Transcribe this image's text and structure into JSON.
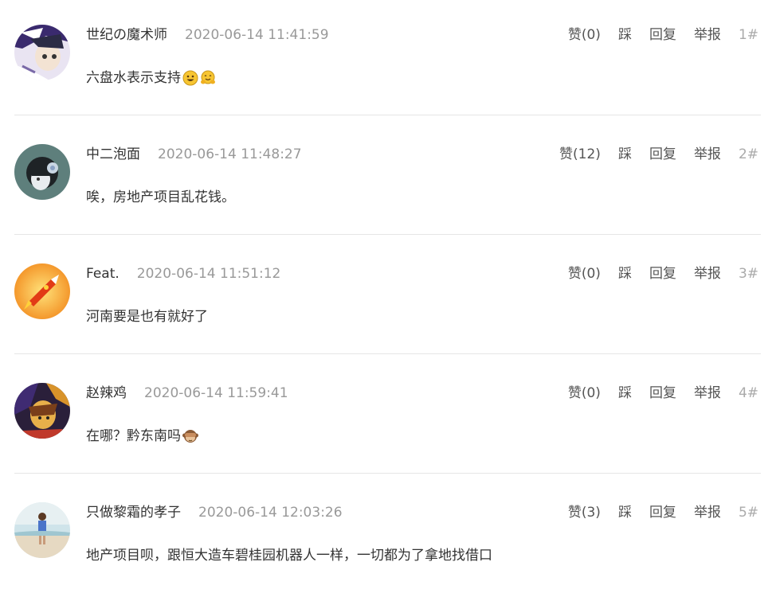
{
  "colors": {
    "text": "#333333",
    "muted": "#999999",
    "divider": "#e6e6e6"
  },
  "comments": [
    {
      "username": "世纪の魔术师",
      "time": "2020-06-14 11:41:59",
      "like": "赞(0)",
      "dislike": "踩",
      "reply": "回复",
      "report": "举报",
      "floor": "1#",
      "text": "六盘水表示支持",
      "emojis": [
        "grinning-face-emoji",
        "hugging-face-emoji"
      ],
      "avatar": "anime-magician-avatar"
    },
    {
      "username": "中二泡面",
      "time": "2020-06-14 11:48:27",
      "like": "赞(12)",
      "dislike": "踩",
      "reply": "回复",
      "report": "举报",
      "floor": "2#",
      "text": "唉，房地产项目乱花钱。",
      "emojis": [],
      "avatar": "anime-dark-hair-avatar"
    },
    {
      "username": "Feat.",
      "time": "2020-06-14 11:51:12",
      "like": "赞(0)",
      "dislike": "踩",
      "reply": "回复",
      "report": "举报",
      "floor": "3#",
      "text": "河南要是也有就好了",
      "emojis": [],
      "avatar": "orange-rocket-avatar"
    },
    {
      "username": "赵辣鸡",
      "time": "2020-06-14 11:59:41",
      "like": "赞(0)",
      "dislike": "踩",
      "reply": "回复",
      "report": "举报",
      "floor": "4#",
      "text": "在哪？黔东南吗",
      "emojis": [
        "see-no-evil-monkey-emoji"
      ],
      "avatar": "colorful-character-avatar"
    },
    {
      "username": "只做黎霜的孝子",
      "time": "2020-06-14 12:03:26",
      "like": "赞(3)",
      "dislike": "踩",
      "reply": "回复",
      "report": "举报",
      "floor": "5#",
      "text": "地产项目呗，跟恒大造车碧桂园机器人一样，一切都为了拿地找借口",
      "emojis": [],
      "avatar": "beach-person-avatar"
    }
  ]
}
